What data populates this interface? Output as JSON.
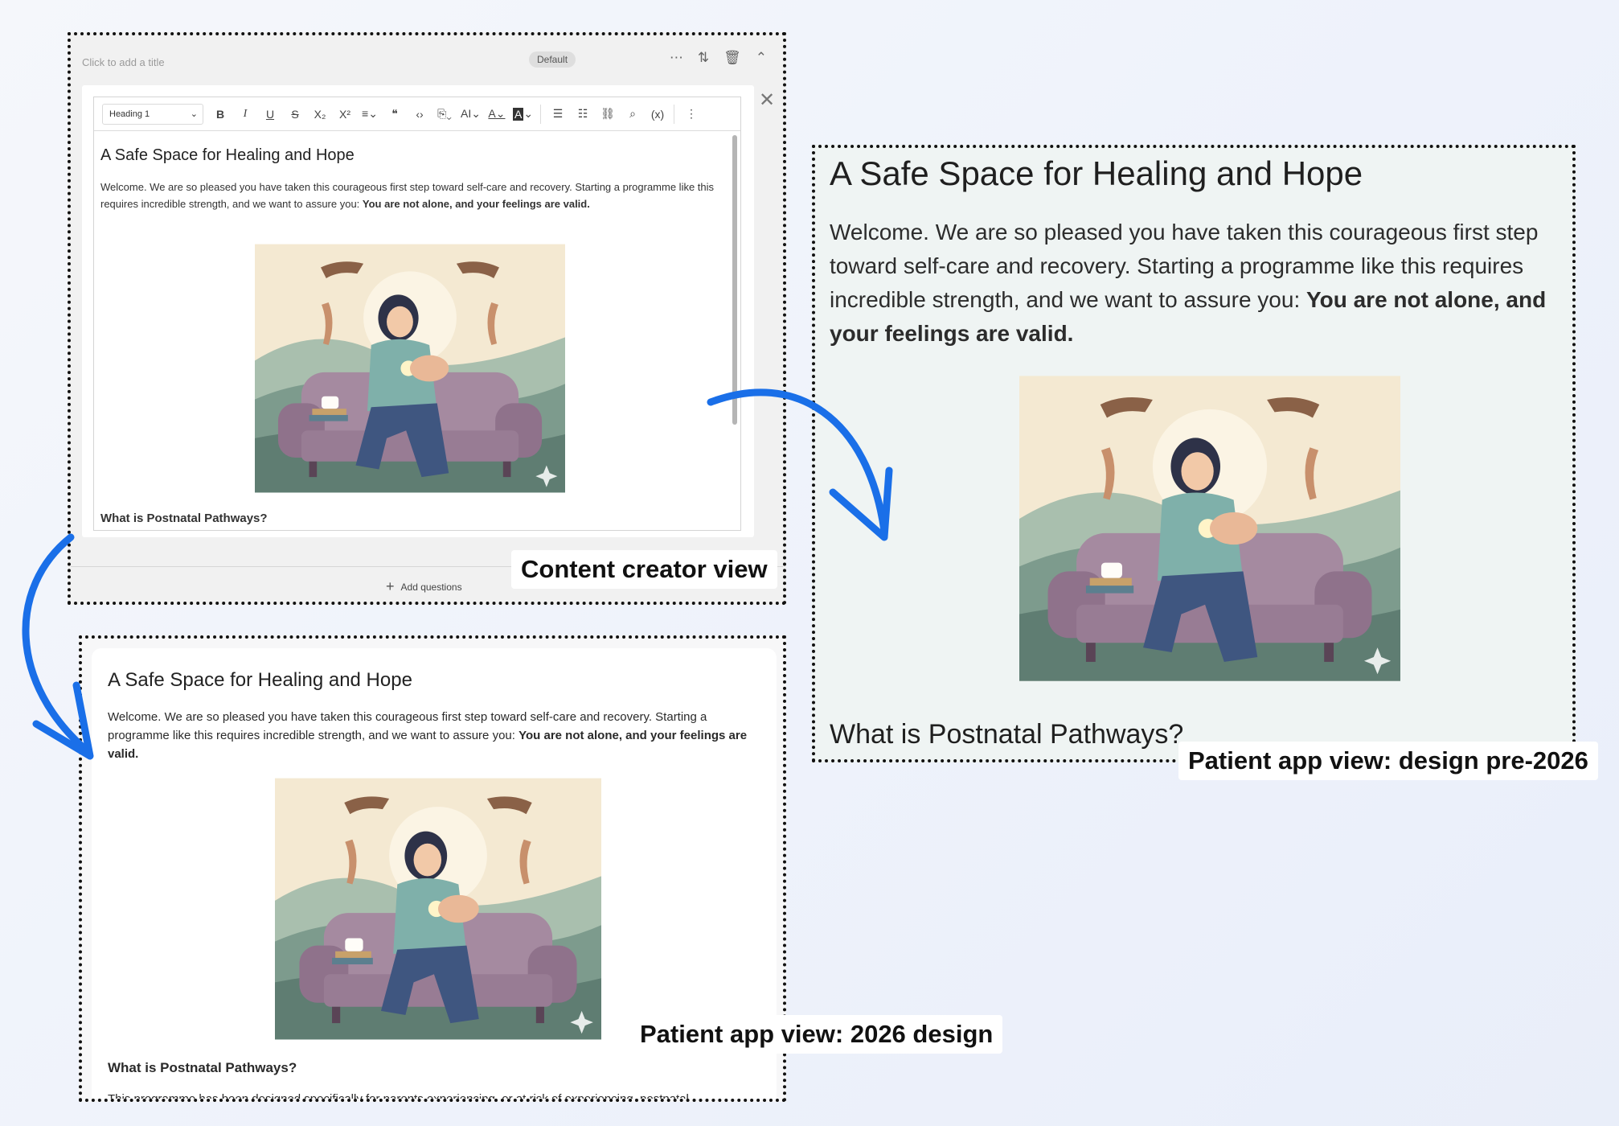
{
  "creator": {
    "title_placeholder": "Click to add a title",
    "badge": "Default",
    "icons": [
      "more-icon",
      "reorder-icon",
      "trash-icon",
      "collapse-icon",
      "close-icon"
    ],
    "toolbar": {
      "heading_select": "Heading 1",
      "buttons": [
        "B",
        "I",
        "U",
        "S",
        "X₂",
        "X²",
        "≡",
        "❝",
        "<>",
        "⎘",
        "AI",
        "A",
        "A",
        "☰",
        "☰",
        "🔗",
        "⌕",
        "(x)",
        "⋮"
      ]
    },
    "heading": "A Safe Space for Healing and Hope",
    "paragraph_intro": "Welcome. We are so pleased you have taken this courageous first step toward self-care and recovery. Starting a programme like this requires incredible strength, and we want to assure you: ",
    "paragraph_bold": "You are not alone, and your feelings are valid.",
    "subheading": "What is Postnatal Pathways?",
    "add_questions": "Add questions"
  },
  "new_view": {
    "heading": "A Safe Space for Healing and Hope",
    "paragraph_intro": "Welcome. We are so pleased you have taken this courageous first step toward self-care and recovery. Starting a programme like this requires incredible strength, and we want to assure you: ",
    "paragraph_bold": "You are not alone, and your feelings are valid.",
    "subheading": "What is Postnatal Pathways?",
    "paragraph_2": "This programme has been designed specifically for parents experiencing, or at risk of experiencing, postnatal"
  },
  "old_view": {
    "heading": "A Safe Space for Healing and Hope",
    "paragraph_intro": "Welcome. We are so pleased you have taken this courageous first step toward self-care and recovery. Starting a programme like this requires incredible strength, and we want to assure you: ",
    "paragraph_bold": "You are not alone, and your feelings are valid.",
    "subheading": "What is Postnatal Pathways?"
  },
  "captions": {
    "creator": "Content creator view",
    "new": "Patient app view: 2026 design",
    "old": "Patient app view: design pre-2026"
  },
  "colors": {
    "arrow": "#1a6fe8",
    "old_view_bg": "#eff4f3",
    "creator_bg": "#f1f1f1"
  }
}
